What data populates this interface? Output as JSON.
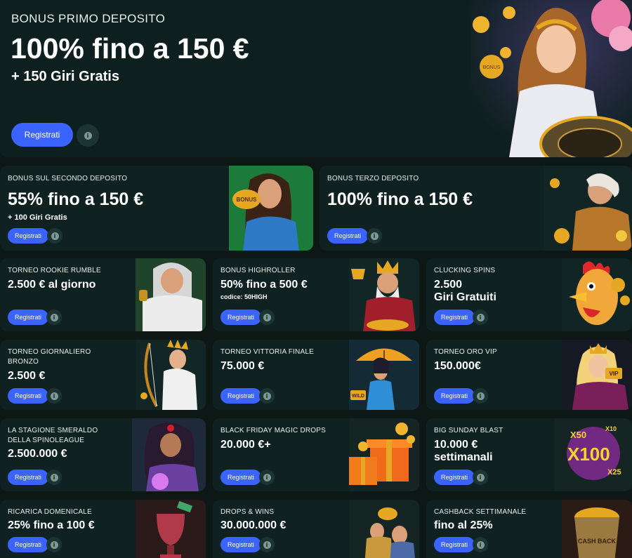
{
  "hero": {
    "subtitle": "BONUS PRIMO DEPOSITO",
    "title": "100% fino a 150 €",
    "extra": "+ 150 Giri Gratis",
    "button": "Registrati",
    "info": "i",
    "badge_text": "BONUS"
  },
  "cards": [
    {
      "subtitle": "BONUS SUL SECONDO DEPOSITO",
      "title": "55% fino a 150 €",
      "extra": "+ 100 Giri Gratis",
      "button": "Registrati",
      "info": "i",
      "badge": "BONUS"
    },
    {
      "subtitle": "BONUS TERZO DEPOSITO",
      "title": "100% fino a 150 €",
      "button": "Registrati",
      "info": "i"
    },
    {
      "subtitle": "TORNEO ROOKIE RUMBLE",
      "title": "2.500 € al giorno",
      "button": "Registrati",
      "info": "i"
    },
    {
      "subtitle": "BONUS HIGHROLLER",
      "title": "50% fino a 500 €",
      "extra": "codice: 50HIGH",
      "button": "Registrati",
      "info": "i"
    },
    {
      "subtitle": "CLUCKING SPINS",
      "title_line1": "2.500",
      "title_line2": "Giri Gratuiti",
      "button": "Registrati",
      "info": "i"
    },
    {
      "subtitle_line1": "TORNEO GIORNALIERO",
      "subtitle_line2": "BRONZO",
      "title": "2.500 €",
      "button": "Registrati",
      "info": "i"
    },
    {
      "subtitle": "TORNEO VITTORIA FINALE",
      "title": "75.000 €",
      "button": "Registrati",
      "info": "i",
      "badge": "WILD"
    },
    {
      "subtitle": "TORNEO ORO VIP",
      "title": "150.000€",
      "button": "Registrati",
      "info": "i",
      "badge": "VIP"
    },
    {
      "subtitle_line1": "LA STAGIONE SMERALDO",
      "subtitle_line2": "DELLA SPINOLEAGUE",
      "title": "2.500.000 €",
      "button": "Registrati",
      "info": "i"
    },
    {
      "subtitle": "BLACK FRIDAY MAGIC DROPS",
      "title": "20.000 €+",
      "button": "Registrati",
      "info": "i"
    },
    {
      "subtitle": "BIG SUNDAY BLAST",
      "title_line1": "10.000 €",
      "title_line2": "settimanali",
      "button": "Registrati",
      "info": "i",
      "badges": [
        "X50",
        "X10",
        "X100",
        "X25"
      ]
    },
    {
      "subtitle": "RICARICA DOMENICALE",
      "title": "25% fino a 100 €",
      "button": "Registrati",
      "info": "i"
    },
    {
      "subtitle": "DROPS & WINS",
      "title": "30.000.000 €",
      "button": "Registrati",
      "info": "i"
    },
    {
      "subtitle": "CASHBACK SETTIMANALE",
      "title": "fino al 25%",
      "button": "Registrati",
      "info": "i",
      "badge": "CASH BACK"
    }
  ],
  "colors": {
    "bg": "#0c1716",
    "card": "#0f2221",
    "button": "#3b63ff",
    "gold": "#e6a822"
  }
}
